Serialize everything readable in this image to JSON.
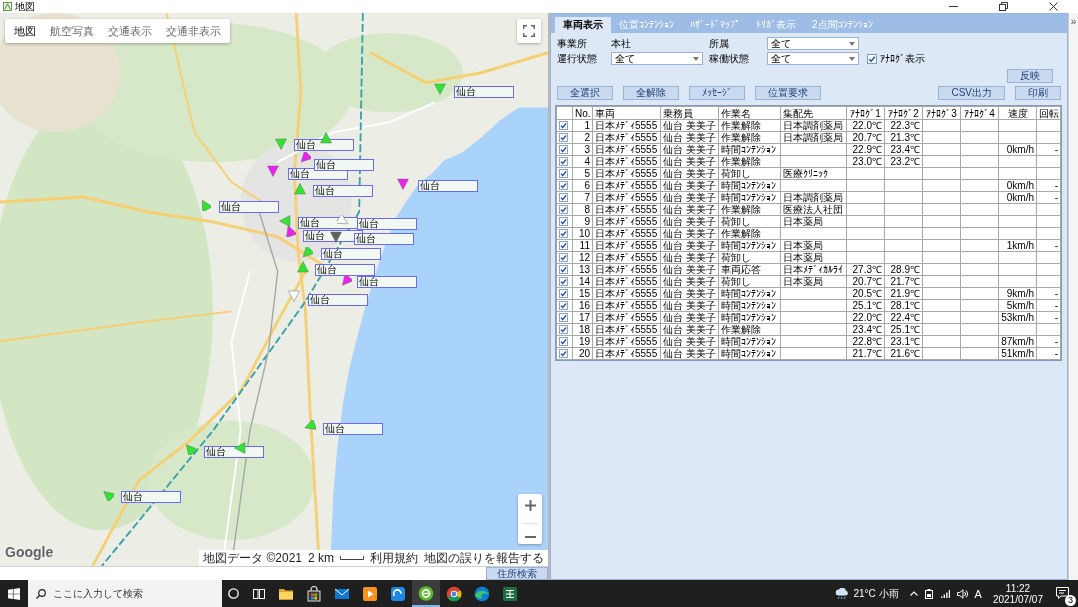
{
  "window": {
    "title": "地図"
  },
  "map": {
    "map_types": [
      {
        "label": "地図",
        "selected": true
      },
      {
        "label": "航空写真",
        "selected": false
      },
      {
        "label": "交通表示",
        "selected": false
      },
      {
        "label": "交通非表示",
        "selected": false
      }
    ],
    "markers": [
      {
        "color": "#2ee62e",
        "label": "仙台"
      },
      {
        "color": "#2ee62e",
        "label": "仙台"
      },
      {
        "color": "#2ee62e"
      },
      {
        "color": "#ee22ee",
        "label": "仙台"
      },
      {
        "color": "#ee22ee",
        "label": "仙台"
      },
      {
        "color": "#2ee62e",
        "label": "仙台"
      },
      {
        "color": "#ee22ee",
        "label": "仙台"
      },
      {
        "color": "#2ee62e",
        "label": "仙台"
      },
      {
        "color": "#2ee62e",
        "label": "仙台"
      },
      {
        "color": "#ffffff",
        "label": "仙台"
      },
      {
        "color": "#ee22ee",
        "label": "仙台"
      },
      {
        "color": "#606060",
        "label": "仙台"
      },
      {
        "color": "#2ee62e",
        "label": "仙台"
      },
      {
        "color": "#2ee62e",
        "label": "仙台"
      },
      {
        "color": "#ee22ee",
        "label": "仙台"
      },
      {
        "color": "#ffffff",
        "label": "仙台"
      },
      {
        "color": "#2ee62e",
        "label": "仙台"
      },
      {
        "color": "#2ee62e",
        "label": "仙台"
      },
      {
        "color": "#2ee62e"
      },
      {
        "color": "#2ee62e",
        "label": "仙台"
      }
    ],
    "logo": "Google",
    "data_credit": "地図データ ©2021",
    "scale": "2 km",
    "links": [
      "利用規約",
      "地図の誤りを報告する"
    ]
  },
  "address_search_button": "住所検索",
  "panel": {
    "tabs": [
      {
        "label": "車両表示",
        "selected": true
      },
      {
        "label": "位置ｺﾝﾃﾝｼｮﾝ",
        "selected": false
      },
      {
        "label": "ﾊｻﾞｰﾄﾞﾏｯﾌﾟ",
        "selected": false
      },
      {
        "label": "ﾄﾘｶﾞ表示",
        "selected": false
      },
      {
        "label": "2点間ｺﾝﾃﾝｼｮﾝ",
        "selected": false
      }
    ],
    "office": {
      "label": "事業所",
      "value": "本社"
    },
    "filters": [
      {
        "label": "所属",
        "value": "全て"
      },
      {
        "label": "運行状態",
        "value": "全て"
      },
      {
        "label": "稼働状態",
        "value": "全て"
      }
    ],
    "analog_display": {
      "label": "ｱﾅﾛｸﾞ表示",
      "checked": true
    },
    "apply_button": "反映",
    "left_buttons": [
      "全選択",
      "全解除",
      "ﾒｯｾｰｼﾞ",
      "位置要求"
    ],
    "right_buttons": [
      "CSV出力",
      "印刷"
    ],
    "table": {
      "columns": [
        "No.",
        "車両",
        "乗務員",
        "作業名",
        "集配先",
        "ｱﾅﾛｸﾞ1",
        "ｱﾅﾛｸﾞ2",
        "ｱﾅﾛｸﾞ3",
        "ｱﾅﾛｸﾞ4",
        "速度",
        "回転"
      ],
      "rows": [
        {
          "checked": true,
          "no": "1",
          "vehicle": "日本ﾒﾃﾞｨ5555",
          "crew": "仙台 美美子",
          "task": "作業解除",
          "destination": "日本調剤薬局",
          "analog_1": "22.0℃",
          "analog_2": "22.3℃"
        },
        {
          "checked": true,
          "no": "2",
          "vehicle": "日本ﾒﾃﾞｨ5555",
          "crew": "仙台 美美子",
          "task": "作業解除",
          "destination": "日本調剤薬局",
          "analog_1": "20.7℃",
          "analog_2": "21.3℃"
        },
        {
          "checked": true,
          "no": "3",
          "vehicle": "日本ﾒﾃﾞｨ5555",
          "crew": "仙台 美美子",
          "task": "時間ｺﾝﾃﾝｼｮﾝ",
          "analog_1": "22.9℃",
          "analog_2": "23.4℃",
          "speed": "0km/h",
          "rotation": "-"
        },
        {
          "checked": true,
          "no": "4",
          "vehicle": "日本ﾒﾃﾞｨ5555",
          "crew": "仙台 美美子",
          "task": "作業解除",
          "analog_1": "23.0℃",
          "analog_2": "23.2℃"
        },
        {
          "checked": true,
          "no": "5",
          "vehicle": "日本ﾒﾃﾞｨ5555",
          "crew": "仙台 美美子",
          "task": "荷卸し",
          "destination": "医療ｸﾘﾆｯｸ"
        },
        {
          "checked": true,
          "no": "6",
          "vehicle": "日本ﾒﾃﾞｨ5555",
          "crew": "仙台 美美子",
          "task": "時間ｺﾝﾃﾝｼｮﾝ",
          "speed": "0km/h",
          "rotation": "-"
        },
        {
          "checked": true,
          "no": "7",
          "vehicle": "日本ﾒﾃﾞｨ5555",
          "crew": "仙台 美美子",
          "task": "時間ｺﾝﾃﾝｼｮﾝ",
          "destination": "日本調剤薬局",
          "speed": "0km/h",
          "rotation": "-"
        },
        {
          "checked": true,
          "no": "8",
          "vehicle": "日本ﾒﾃﾞｨ5555",
          "crew": "仙台 美美子",
          "task": "作業解除",
          "destination": "医療法人社団"
        },
        {
          "checked": true,
          "no": "9",
          "vehicle": "日本ﾒﾃﾞｨ5555",
          "crew": "仙台 美美子",
          "task": "荷卸し",
          "destination": "日本薬局"
        },
        {
          "checked": true,
          "no": "10",
          "vehicle": "日本ﾒﾃﾞｨ5555",
          "crew": "仙台 美美子",
          "task": "作業解除"
        },
        {
          "checked": true,
          "no": "11",
          "vehicle": "日本ﾒﾃﾞｨ5555",
          "crew": "仙台 美美子",
          "task": "時間ｺﾝﾃﾝｼｮﾝ",
          "destination": "日本薬局",
          "speed": "1km/h",
          "rotation": "-"
        },
        {
          "checked": true,
          "no": "12",
          "vehicle": "日本ﾒﾃﾞｨ5555",
          "crew": "仙台 美美子",
          "task": "荷卸し",
          "destination": "日本薬局"
        },
        {
          "checked": true,
          "no": "13",
          "vehicle": "日本ﾒﾃﾞｨ5555",
          "crew": "仙台 美美子",
          "task": "車両応答",
          "destination": "日本ﾒﾃﾞｨｶﾙﾗｲ",
          "analog_1": "27.3℃",
          "analog_2": "28.9℃"
        },
        {
          "checked": true,
          "no": "14",
          "vehicle": "日本ﾒﾃﾞｨ5555",
          "crew": "仙台 美美子",
          "task": "荷卸し",
          "destination": "日本薬局",
          "analog_1": "20.7℃",
          "analog_2": "21.7℃"
        },
        {
          "checked": true,
          "no": "15",
          "vehicle": "日本ﾒﾃﾞｨ5555",
          "crew": "仙台 美美子",
          "task": "時間ｺﾝﾃﾝｼｮﾝ",
          "analog_1": "20.5℃",
          "analog_2": "21.9℃",
          "speed": "9km/h",
          "rotation": "-"
        },
        {
          "checked": true,
          "no": "16",
          "vehicle": "日本ﾒﾃﾞｨ5555",
          "crew": "仙台 美美子",
          "task": "時間ｺﾝﾃﾝｼｮﾝ",
          "analog_1": "25.1℃",
          "analog_2": "28.1℃",
          "speed": "5km/h",
          "rotation": "-"
        },
        {
          "checked": true,
          "no": "17",
          "vehicle": "日本ﾒﾃﾞｨ5555",
          "crew": "仙台 美美子",
          "task": "時間ｺﾝﾃﾝｼｮﾝ",
          "analog_1": "22.0℃",
          "analog_2": "22.4℃",
          "speed": "53km/h",
          "rotation": "-"
        },
        {
          "checked": true,
          "no": "18",
          "vehicle": "日本ﾒﾃﾞｨ5555",
          "crew": "仙台 美美子",
          "task": "作業解除",
          "analog_1": "23.4℃",
          "analog_2": "25.1℃"
        },
        {
          "checked": true,
          "no": "19",
          "vehicle": "日本ﾒﾃﾞｨ5555",
          "crew": "仙台 美美子",
          "task": "時間ｺﾝﾃﾝｼｮﾝ",
          "analog_1": "22.8℃",
          "analog_2": "23.1℃",
          "speed": "87km/h",
          "rotation": "-"
        },
        {
          "checked": true,
          "no": "20",
          "vehicle": "日本ﾒﾃﾞｨ5555",
          "crew": "仙台 美美子",
          "task": "時間ｺﾝﾃﾝｼｮﾝ",
          "analog_1": "21.7℃",
          "analog_2": "21.6℃",
          "speed": "51km/h",
          "rotation": "-"
        }
      ]
    }
  },
  "side_toggle": "»",
  "taskbar": {
    "search": {
      "placeholder": "ここに入力して検索"
    },
    "apps": [
      {
        "kind": "folder",
        "selected": false
      },
      {
        "kind": "store",
        "selected": false
      },
      {
        "kind": "mail",
        "selected": false
      },
      {
        "kind": "player",
        "selected": false
      },
      {
        "kind": "swirl",
        "selected": false
      },
      {
        "kind": "ring",
        "selected": true
      },
      {
        "kind": "chrome",
        "selected": false
      },
      {
        "kind": "edge",
        "selected": false
      },
      {
        "kind": "sheet",
        "selected": false
      }
    ],
    "weather": "21°C 小雨",
    "ime": "A",
    "time": "11:22",
    "date": "2021/07/07",
    "notification_count": "3"
  }
}
